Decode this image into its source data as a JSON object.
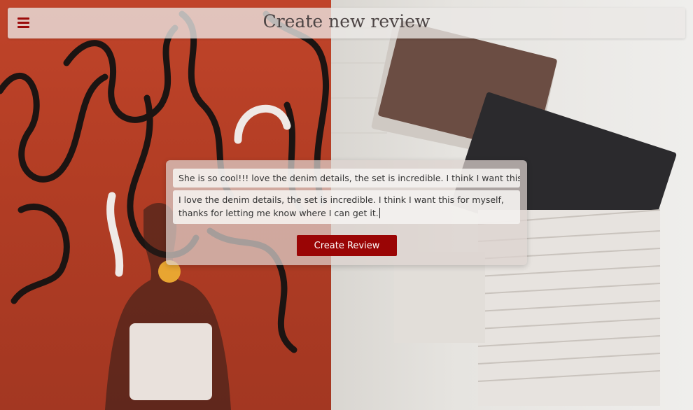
{
  "header": {
    "title": "Create new review",
    "menu_icon": "hamburger-menu-icon"
  },
  "review_form": {
    "title_value": "She is so cool!!! love the denim details, the set is incredible. I think I want this",
    "body_value": "I love the denim details, the set is incredible. I think I want this for myself, thanks for letting me know where I can get it.",
    "submit_label": "Create Review"
  },
  "colors": {
    "accent": "#9a0505",
    "title_text": "#4d4545",
    "left_panel": "#b23d24",
    "right_panel": "#e6e4e0"
  }
}
